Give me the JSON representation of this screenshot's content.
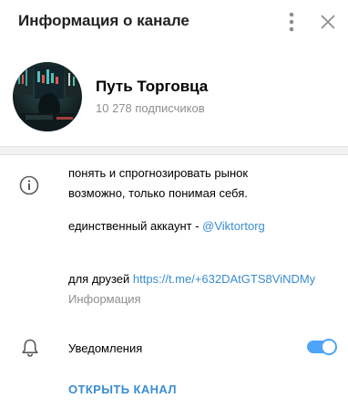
{
  "header": {
    "title": "Информация о канале",
    "more_icon": "vertical-dots-icon",
    "close_icon": "close-icon"
  },
  "channel": {
    "name": "Путь Торговца",
    "subscribers": "10 278 подписчиков"
  },
  "about": {
    "lines": [
      "понять и спрогнозировать рынок",
      "возможно, только понимая себя."
    ],
    "account_prefix": "единственный аккаунт - ",
    "account_link": "@Viktortorg",
    "friends_prefix": "для друзей ",
    "friends_link": "https://t.me/+632DAtGTS8ViNDMy",
    "caption": "Информация"
  },
  "notifications": {
    "label": "Уведомления",
    "enabled": true
  },
  "actions": {
    "open_channel": "ОТКРЫТЬ КАНАЛ"
  },
  "colors": {
    "accent": "#3a8dd0",
    "toggle": "#4ea4f6",
    "secondary_text": "#8f8f8f",
    "divider": "#f1f1f1"
  }
}
